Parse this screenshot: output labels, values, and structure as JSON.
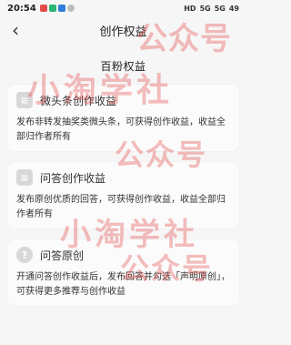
{
  "status": {
    "time": "20:54",
    "right": [
      "HD",
      "5G",
      "5G",
      "49"
    ]
  },
  "nav": {
    "title": "创作权益"
  },
  "page": {
    "section_title": "百粉权益",
    "cards": [
      {
        "title": "微头条创作收益",
        "desc": "发布非转发抽奖类微头条，可获得创作收益，收益全部归作者所有",
        "icon": "document-icon"
      },
      {
        "title": "问答创作收益",
        "desc": "发布原创优质的回答，可获得创作收益，收益全部归作者所有",
        "icon": "document-icon"
      },
      {
        "title": "问答原创",
        "desc": "开通问答创作收益后，发布回答并勾选「声明原创」，可获得更多推荐与创作收益",
        "icon": "question-icon"
      }
    ]
  },
  "watermark": {
    "lines": [
      "公众号",
      "小淘学社",
      "公众号",
      "小淘学社",
      "公众号"
    ]
  }
}
